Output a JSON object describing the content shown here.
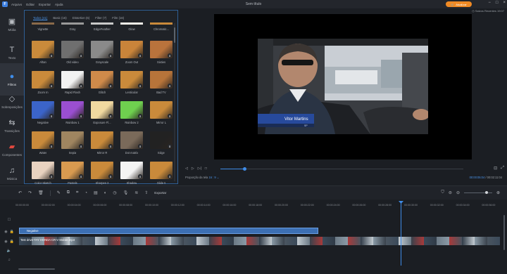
{
  "titlebar": {
    "logo": "F",
    "menus": [
      "Arquivo",
      "Editar",
      "Exportar",
      "Ajuda"
    ],
    "title": "Sem título",
    "upgrade_label": "Atualizar",
    "recent": "Salvos Recentes 19:07"
  },
  "sidebar": [
    {
      "label": "Mídia",
      "icon": "media-icon"
    },
    {
      "label": "Texto",
      "icon": "text-icon"
    },
    {
      "label": "Filtros",
      "icon": "filter-icon"
    },
    {
      "label": "Sobreposições",
      "icon": "overlay-icon"
    },
    {
      "label": "Transições",
      "icon": "transition-icon"
    },
    {
      "label": "Componentes",
      "icon": "component-icon"
    },
    {
      "label": "Música",
      "icon": "music-icon"
    }
  ],
  "filters": {
    "tabs": [
      "Todos (41)",
      "Basic (16)",
      "Distortion (6)",
      "Filter (7)",
      "Film (16)"
    ],
    "top_labels": [
      "Vignette",
      "Gray",
      "EdgeFeather",
      "Glow",
      "Chromatic..."
    ],
    "items": [
      {
        "label": "Aftan",
        "thumb": "#c98a3b"
      },
      {
        "label": "Old video",
        "thumb": "#6f6f6f"
      },
      {
        "label": "Grayscale",
        "thumb": "#8a8a8a"
      },
      {
        "label": "Zoom Out",
        "thumb": "#c9843a"
      },
      {
        "label": "Sixties",
        "thumb": "#b9733c"
      },
      {
        "label": "Zoom In",
        "thumb": "#c98a3b"
      },
      {
        "label": "Rapid Flash",
        "thumb": "#f2f2f2"
      },
      {
        "label": "Glitch",
        "thumb": "#cf8a4a"
      },
      {
        "label": "Lenticular",
        "thumb": "#c98a3b"
      },
      {
        "label": "Bad TV",
        "thumb": "#b7743a"
      },
      {
        "label": "Negative",
        "thumb": "#3b64c9"
      },
      {
        "label": "Rainbow 1",
        "thumb": "#9a4fd0"
      },
      {
        "label": "Exposure Fl...",
        "thumb": "#f0d9a0"
      },
      {
        "label": "Rainbow 2",
        "thumb": "#6fd04f"
      },
      {
        "label": "Mirror L",
        "thumb": "#c98a3b"
      },
      {
        "label": "Water",
        "thumb": "#c98a3b"
      },
      {
        "label": "Sepia",
        "thumb": "#9f8560"
      },
      {
        "label": "Mirror R",
        "thumb": "#c98a3b"
      },
      {
        "label": "Dot matrix",
        "thumb": "#7a6a5a"
      },
      {
        "label": "Edge",
        "thumb": "#222222"
      },
      {
        "label": "Color Sketch",
        "thumb": "#e8d2c0"
      },
      {
        "label": "Pastels",
        "thumb": "#d89a50"
      },
      {
        "label": "Sharpen 3",
        "thumb": "#c98a3b"
      },
      {
        "label": "Shadow",
        "thumb": "#f4f4f4"
      },
      {
        "label": "Glide 5",
        "thumb": "#c98a3b"
      }
    ]
  },
  "player": {
    "caption_name": "Vitor Martins",
    "caption_sub": "SP",
    "aspect_label": "Proporção da tela",
    "aspect_value": "16 : 9",
    "current_time": "00:00:05:04",
    "total_time": "00:02:11:04",
    "progress": 0.1
  },
  "timeline": {
    "export_label": "Exportar",
    "ruler": [
      "00:00:00:00",
      "00:00:02:00",
      "00:00:04:00",
      "00:00:06:00",
      "00:00:08:00",
      "00:00:10:00",
      "00:00:12:00",
      "00:00:14:00",
      "00:00:16:00",
      "00:00:18:00",
      "00:00:20:00",
      "00:00:22:00",
      "00:00:24:00",
      "00:00:26:00",
      "00:00:28:00",
      "00:00:30:00",
      "00:00:32:00",
      "00:00:34:00",
      "00:00:36:00"
    ],
    "effect_clip": "Negative",
    "video_clip": "Test drive-TAY HONDA CR-V Mobile.mp4"
  },
  "colors": {
    "accent": "#3f8ce8",
    "upgrade": "#f08a24",
    "effect_clip": "#3c6fb3"
  }
}
